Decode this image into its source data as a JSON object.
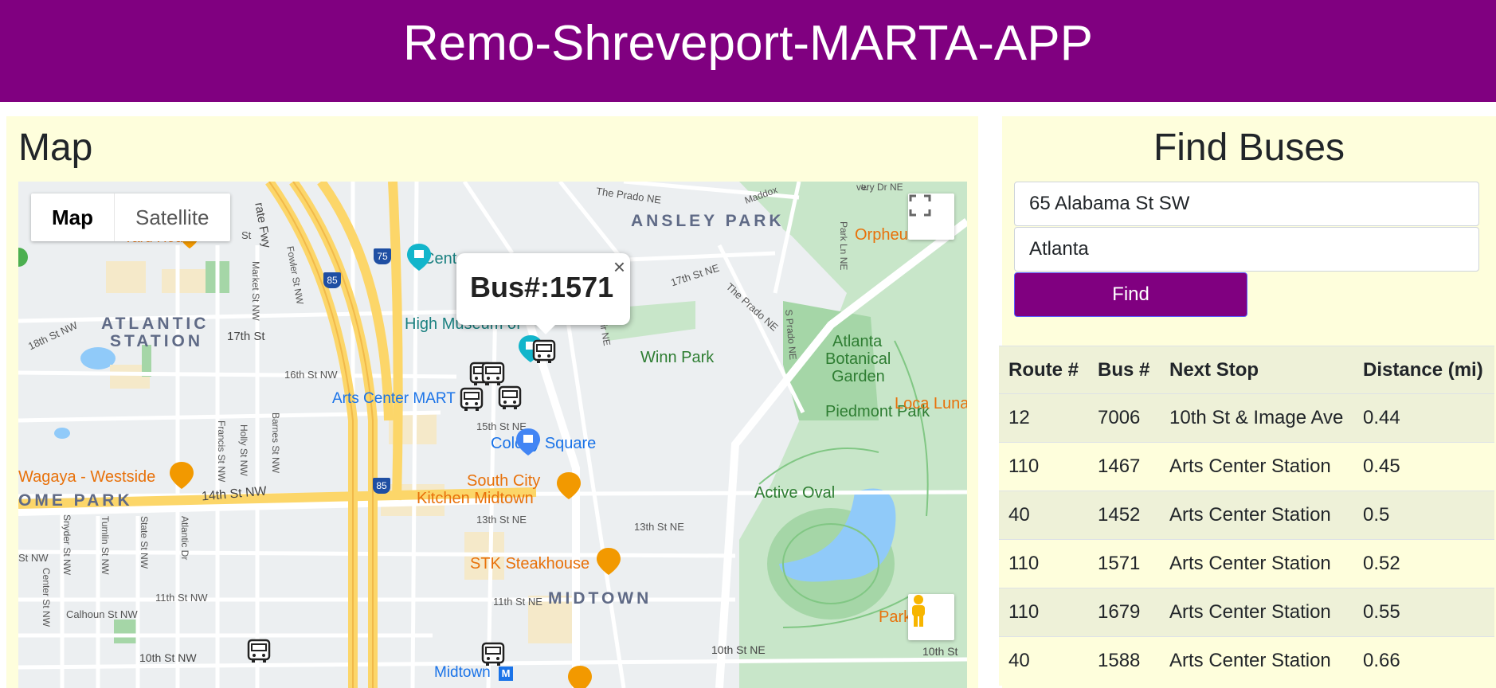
{
  "app": {
    "title": "Remo-Shreveport-MARTA-APP"
  },
  "map_panel": {
    "title": "Map",
    "map_type": {
      "map": "Map",
      "satellite": "Satellite"
    },
    "info_window": {
      "text": "Bus#:1571",
      "close": "×"
    },
    "labels": {
      "ansley_park": "ANSLEY PARK",
      "atlantic_station": "ATLANTIC",
      "atlantic_station2": "STATION",
      "midtown": "MIDTOWN",
      "home_park": "OME PARK",
      "winn_park": "Winn Park",
      "atlanta_botanical": "Atlanta",
      "atlanta_botanical2": "Botanical",
      "atlanta_botanical3": "Garden",
      "piedmont_park": "Piedmont Park",
      "active_oval": "Active Oval",
      "colony_square": "Colony Square",
      "high_museum": "High Museum of",
      "arts_center_marta": "Arts Center MART",
      "south_city": "South City",
      "south_city2": "Kitchen Midtown",
      "stk": "STK Steakhouse",
      "wagaya": "Wagaya - Westside",
      "loca_luna": "Loca Luna",
      "orpheus": "Orpheu",
      "park_tavern": "Park",
      "midtown_station": "Midtown",
      "yard_house": "Yard House",
      "cent": "Cent",
      "st_17th": "17th St",
      "st_17th_ne": "17th St NE",
      "st_16th": "16th St NW",
      "st_15th": "15th St NE",
      "st_14th": "14th St NW",
      "st_13th": "13th St NE",
      "st_13th_b": "13th St NE",
      "st_11th": "11th St NW",
      "st_11th_ne": "11th St NE",
      "st_10th": "10th St NW",
      "st_10th_ne": "10th St NE",
      "st_10th_b": "10th St",
      "st_18th": "18th St NW",
      "prado": "The Prado NE",
      "prado2": "The Prado NE",
      "spring_fwy": "rate Fwy",
      "fowler": "Fowler St NW",
      "market": "Market St NW",
      "francis": "Francis St NW",
      "holly": "Holly St NW",
      "barnes": "Barnes St NW",
      "snyder": "Snyder St NW",
      "tumlin": "Tumlin St NW",
      "state": "State St NW",
      "atlantic_dr": "Atlantic Dr",
      "center": "Center St NW",
      "calhoun": "Calhoun St NW",
      "piedmont_ln": "Park Ln NE",
      "e_park": "E Park Ln NE",
      "prado_s": "S Prado NE",
      "maddox": "Maddox",
      "avery": "very Dr NE",
      "st_nw": "St NW",
      "cir": "Cir NE",
      "st_small": "St",
      "i75": "75",
      "i85": "85",
      "i85b": "85",
      "i85c": "85"
    }
  },
  "find_panel": {
    "title": "Find Buses",
    "street_value": "65 Alabama St SW",
    "city_value": "Atlanta",
    "find_label": "Find"
  },
  "table": {
    "headers": {
      "route": "Route #",
      "bus": "Bus #",
      "next_stop": "Next Stop",
      "distance": "Distance (mi)"
    },
    "rows": [
      {
        "route": "12",
        "bus": "7006",
        "next_stop": "10th St & Image Ave",
        "distance": "0.44"
      },
      {
        "route": "110",
        "bus": "1467",
        "next_stop": "Arts Center Station",
        "distance": "0.45"
      },
      {
        "route": "40",
        "bus": "1452",
        "next_stop": "Arts Center Station",
        "distance": "0.5"
      },
      {
        "route": "110",
        "bus": "1571",
        "next_stop": "Arts Center Station",
        "distance": "0.52"
      },
      {
        "route": "110",
        "bus": "1679",
        "next_stop": "Arts Center Station",
        "distance": "0.55"
      },
      {
        "route": "40",
        "bus": "1588",
        "next_stop": "Arts Center Station",
        "distance": "0.66"
      }
    ]
  },
  "colors": {
    "brand": "#800080",
    "panel": "#fefedc"
  }
}
